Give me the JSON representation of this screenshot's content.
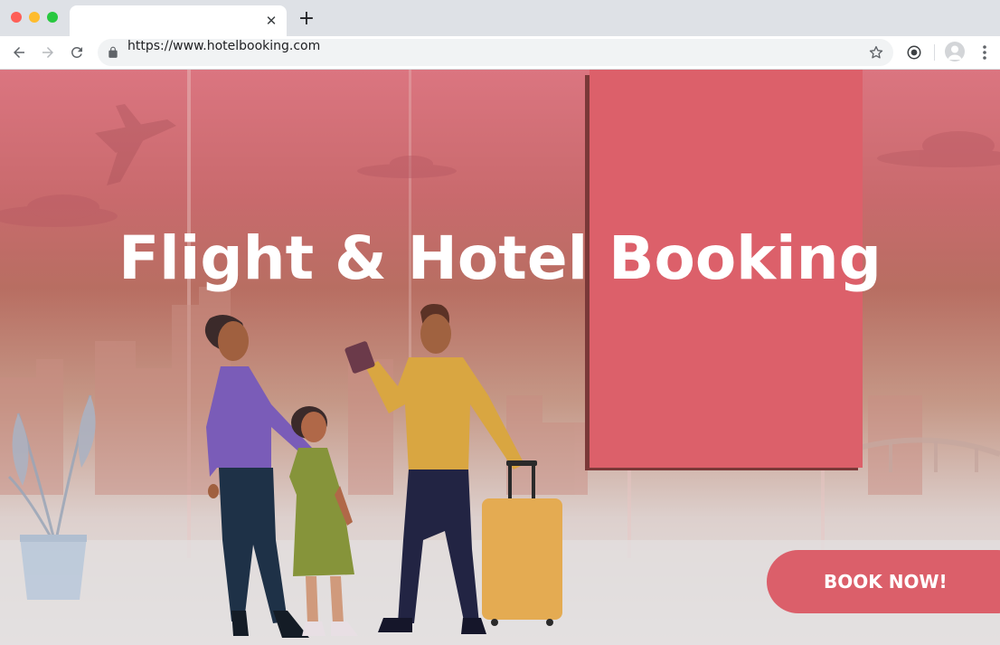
{
  "browser": {
    "tab": {
      "title": ""
    },
    "address_bar": {
      "url": "https://www.hotelbooking.com"
    }
  },
  "hero": {
    "headline": "Flight & Hotel Booking",
    "cta_label": "BOOK NOW!"
  },
  "colors": {
    "accent": "#db5f6a",
    "panel": "#dc606a",
    "panel_shadow": "#7a3838",
    "sky_top": "#db7580"
  },
  "icons": [
    "back-arrow-icon",
    "forward-arrow-icon",
    "reload-icon",
    "lock-icon",
    "bookmark-star-icon",
    "extension-icon",
    "profile-avatar-icon",
    "kebab-menu-icon",
    "close-icon",
    "plus-icon"
  ]
}
